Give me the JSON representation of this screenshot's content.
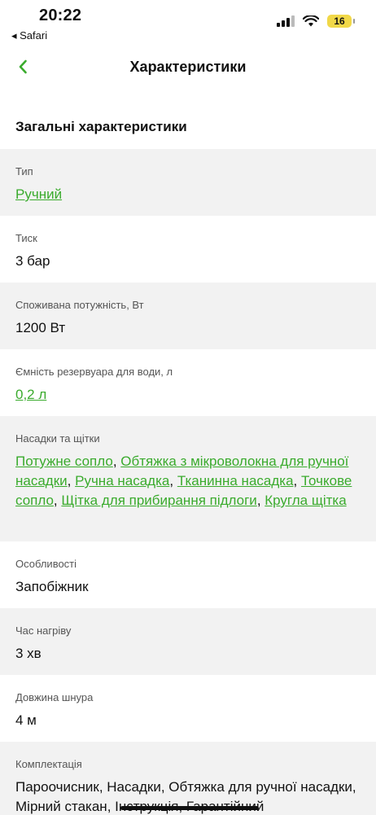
{
  "status_bar": {
    "time": "20:22",
    "back_app": "◂ Safari",
    "battery": "16"
  },
  "header": {
    "title": "Характеристики"
  },
  "section_title": "Загальні характеристики",
  "rows": [
    {
      "label": "Тип",
      "links": [
        "Ручний"
      ]
    },
    {
      "label": "Тиск",
      "value": "3 бар"
    },
    {
      "label": "Споживана потужність, Вт",
      "value": "1200 Вт"
    },
    {
      "label": "Ємність резервуара для води, л",
      "links": [
        "0,2 л"
      ]
    },
    {
      "label": "Насадки та щітки",
      "links": [
        "Потужне сопло",
        "Обтяжка з мікроволокна для ручної насадки",
        "Ручна насадка",
        "Тканинна насадка",
        "Точкове сопло",
        "Щітка для прибирання підлоги",
        "Кругла щітка"
      ]
    },
    {
      "label": "Особливості",
      "value": "Запобіжник"
    },
    {
      "label": "Час нагріву",
      "value": "3 хв"
    },
    {
      "label": "Довжина шнура",
      "value": "4 м"
    },
    {
      "label": "Комплектація",
      "value": "Пароочисник, Насадки, Обтяжка для ручної насадки, Мірний стакан, Інструкція, Гарантійний"
    }
  ],
  "colors": {
    "accent": "#3aab2d",
    "row_gray": "#f2f2f2"
  }
}
